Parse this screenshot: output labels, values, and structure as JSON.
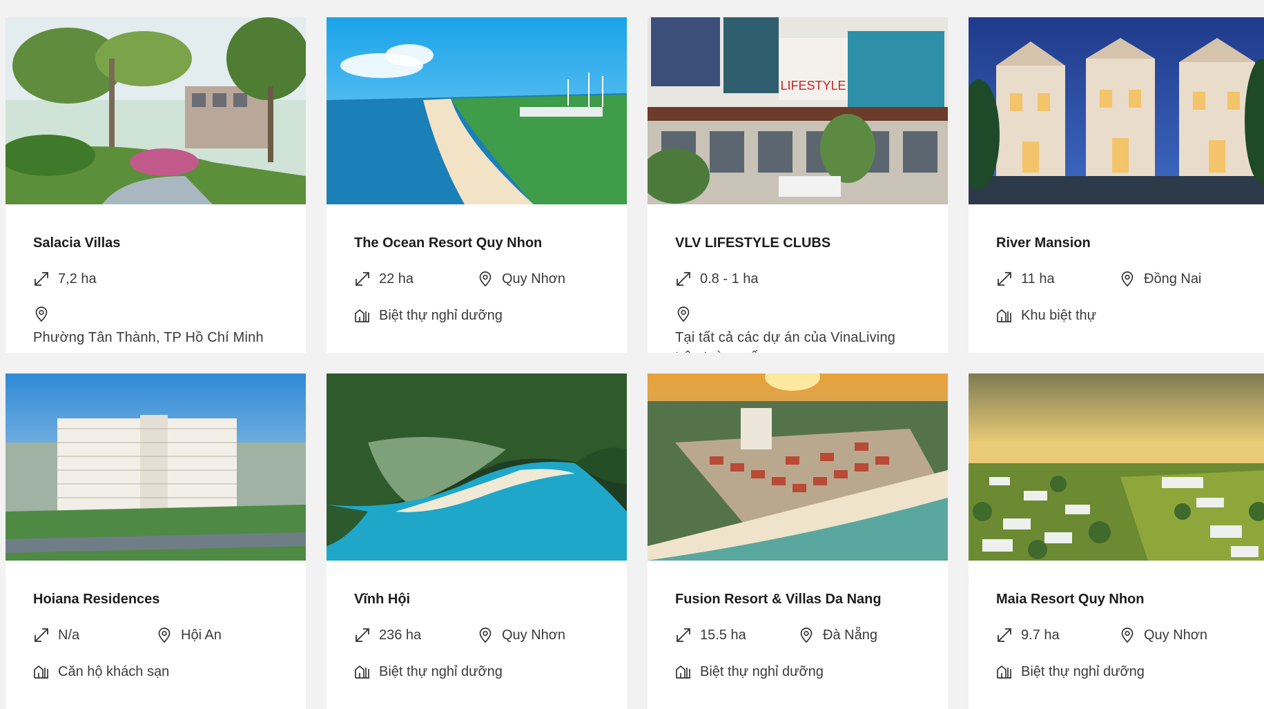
{
  "projects": [
    {
      "title": "Salacia Villas",
      "area": "7,2 ha",
      "location": "Phường Tân Thành, TP Hồ Chí Minh",
      "type": ""
    },
    {
      "title": "The Ocean Resort Quy Nhon",
      "area": "22 ha",
      "location": "Quy Nhơn",
      "type": "Biệt thự nghỉ dưỡng"
    },
    {
      "title": "VLV LIFESTYLE CLUBS",
      "area": "0.8 - 1 ha",
      "location": "Tại tất cả các dự án của VinaLiving trên toàn quốc",
      "type": ""
    },
    {
      "title": "River Mansion",
      "area": "11 ha",
      "location": "Đồng Nai",
      "type": "Khu biệt thự"
    },
    {
      "title": "Hoiana Residences",
      "area": "N/a",
      "location": "Hội An",
      "type": "Căn hộ khách sạn"
    },
    {
      "title": "Vĩnh Hội",
      "area": "236 ha",
      "location": "Quy Nhơn",
      "type": "Biệt thự nghỉ dưỡng"
    },
    {
      "title": "Fusion Resort & Villas Da Nang",
      "area": "15.5 ha",
      "location": "Đà Nẵng",
      "type": "Biệt thự nghỉ dưỡng"
    },
    {
      "title": "Maia Resort Quy Nhon",
      "area": "9.7 ha",
      "location": "Quy Nhơn",
      "type": "Biệt thự nghỉ dưỡng"
    }
  ],
  "images": {
    "img0": "LIFESTYLE"
  },
  "icons": {
    "area": "area-arrow-icon",
    "location": "location-pin-icon",
    "type": "building-type-icon"
  }
}
